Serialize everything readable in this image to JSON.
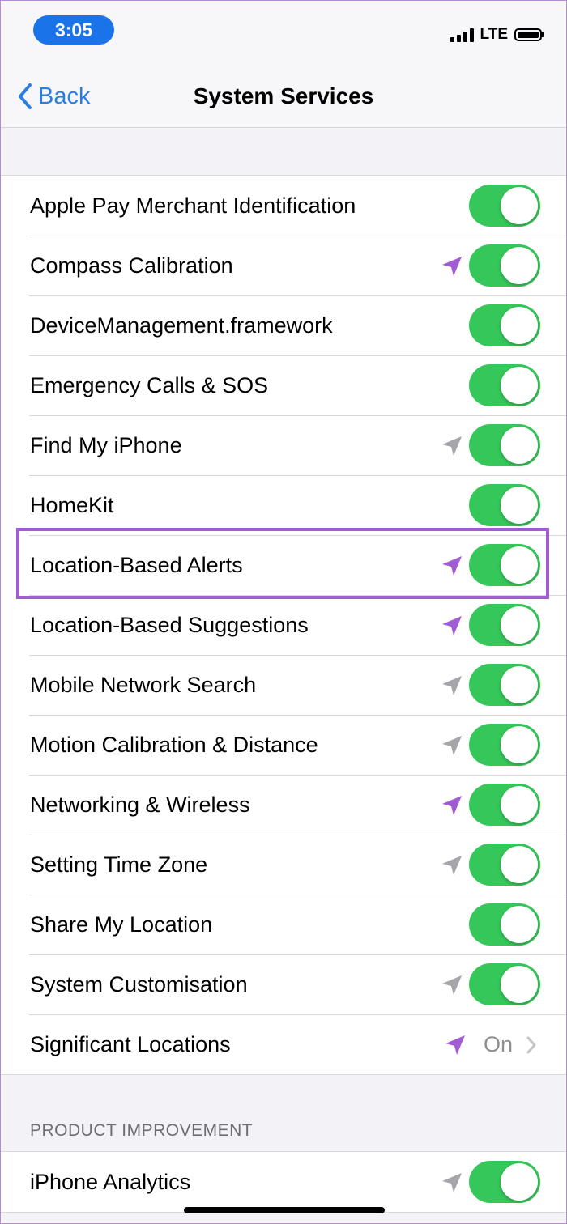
{
  "status_bar": {
    "time": "3:05",
    "network": "LTE",
    "signal_bars": 4,
    "battery_level": 1.0
  },
  "nav": {
    "back_label": "Back",
    "title": "System Services"
  },
  "colors": {
    "toggle_on": "#35c759",
    "location_recent": "#a15cd3",
    "location_past": "#a5a5aa",
    "link_blue": "#2a7de1",
    "highlight": "#a15cd3"
  },
  "services": [
    {
      "label": "Apple Pay Merchant Identification",
      "enabled": true,
      "location_icon": "none"
    },
    {
      "label": "Compass Calibration",
      "enabled": true,
      "location_icon": "recent"
    },
    {
      "label": "DeviceManagement.framework",
      "enabled": true,
      "location_icon": "none"
    },
    {
      "label": "Emergency Calls & SOS",
      "enabled": true,
      "location_icon": "none"
    },
    {
      "label": "Find My iPhone",
      "enabled": true,
      "location_icon": "past"
    },
    {
      "label": "HomeKit",
      "enabled": true,
      "location_icon": "none"
    },
    {
      "label": "Location-Based Alerts",
      "enabled": true,
      "location_icon": "recent",
      "highlighted": true
    },
    {
      "label": "Location-Based Suggestions",
      "enabled": true,
      "location_icon": "recent"
    },
    {
      "label": "Mobile Network Search",
      "enabled": true,
      "location_icon": "past"
    },
    {
      "label": "Motion Calibration & Distance",
      "enabled": true,
      "location_icon": "past"
    },
    {
      "label": "Networking & Wireless",
      "enabled": true,
      "location_icon": "recent"
    },
    {
      "label": "Setting Time Zone",
      "enabled": true,
      "location_icon": "past"
    },
    {
      "label": "Share My Location",
      "enabled": true,
      "location_icon": "none"
    },
    {
      "label": "System Customisation",
      "enabled": true,
      "location_icon": "past"
    },
    {
      "label": "Significant Locations",
      "value": "On",
      "location_icon": "recent",
      "disclosure": true
    }
  ],
  "product_improvement": {
    "header": "PRODUCT IMPROVEMENT",
    "items": [
      {
        "label": "iPhone Analytics",
        "enabled": true,
        "location_icon": "past"
      }
    ]
  }
}
